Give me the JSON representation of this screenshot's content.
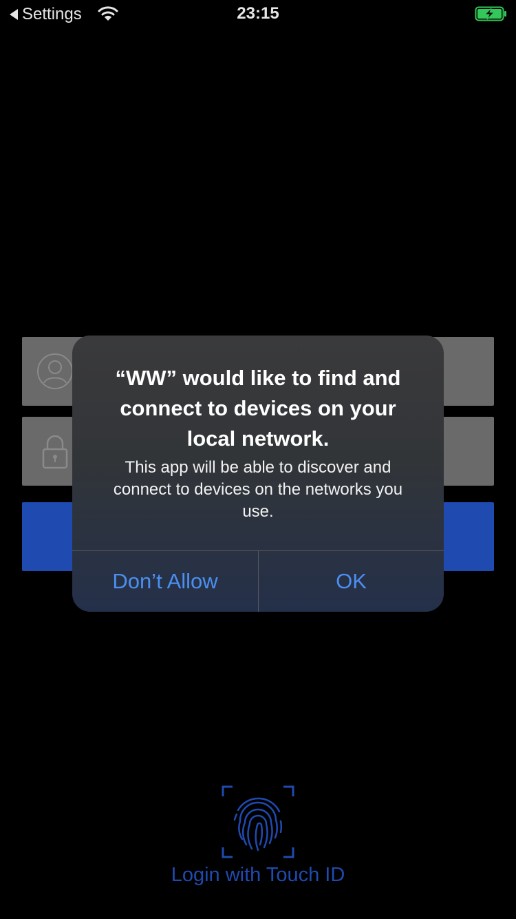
{
  "status_bar": {
    "back_label": "Settings",
    "time": "23:15"
  },
  "login": {
    "touch_id_label": "Login with Touch ID"
  },
  "alert": {
    "title": "“WW” would like to find and connect to devices on your local network.",
    "message": "This app will be able to discover and connect to devices on the networks you use.",
    "deny_label": "Don’t Allow",
    "ok_label": "OK"
  },
  "colors": {
    "accent_blue": "#1f4ab0",
    "alert_button_text": "#4b8ff0",
    "battery_green": "#34c759"
  }
}
